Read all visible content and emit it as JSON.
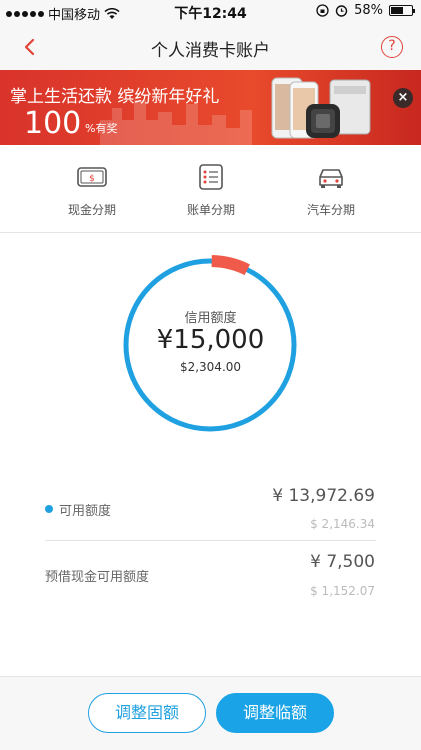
{
  "status_bar": {
    "carrier": "中国移动",
    "time": "下午12:44",
    "battery_percent": "58%",
    "battery_level": 0.58,
    "icons": [
      "signal-dots-icon",
      "wifi-icon",
      "rotation-lock-icon",
      "alarm-icon",
      "battery-icon"
    ]
  },
  "nav": {
    "title": "个人消费卡账户",
    "back_icon": "chevron-left-icon",
    "help_label": "?",
    "accent_color": "#e0433a"
  },
  "banner": {
    "headline": "掌上生活还款  缤纷新年好礼",
    "number": "100",
    "suffix": "%有奖",
    "close_label": "×"
  },
  "categories": [
    {
      "label": "现金分期",
      "icon": "cash-card-icon"
    },
    {
      "label": "账单分期",
      "icon": "bill-list-icon"
    },
    {
      "label": "汽车分期",
      "icon": "car-icon"
    }
  ],
  "credit": {
    "label": "信用额度",
    "amount_cny": "¥15,000",
    "amount_usd": "$2,304.00",
    "used_fraction": 0.07,
    "ring_color": "#1fa0e0",
    "used_color": "#f05a4a"
  },
  "available": {
    "label": "可用额度",
    "amount_cny": "¥ 13,972.69",
    "amount_usd": "$ 2,146.34"
  },
  "cash_advance": {
    "label": "预借现金可用额度",
    "amount_cny": "¥ 7,500",
    "amount_usd": "$ 1,152.07"
  },
  "buttons": {
    "fixed": "调整固额",
    "temporary": "调整临额"
  }
}
